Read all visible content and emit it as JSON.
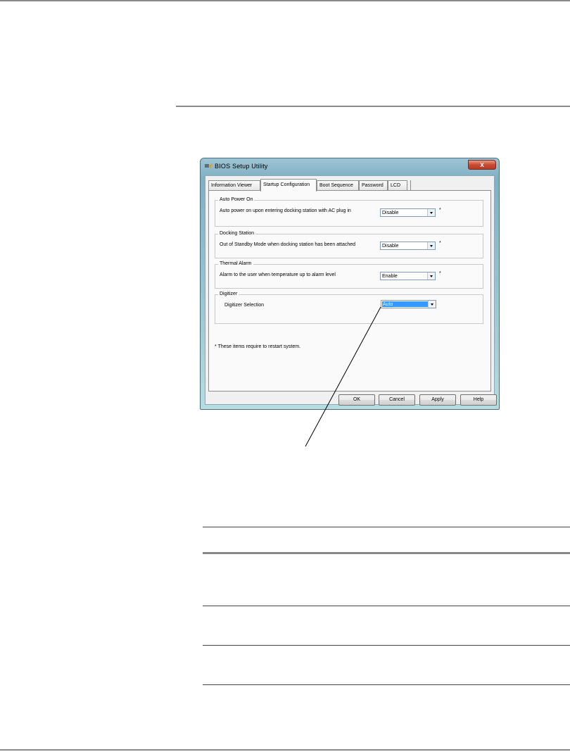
{
  "window": {
    "title": "BIOS Setup Utility",
    "close_glyph": "x"
  },
  "tabs": [
    {
      "label": "Information Viewer"
    },
    {
      "label": "Startup Configuration"
    },
    {
      "label": "Boot Sequence"
    },
    {
      "label": "Password"
    },
    {
      "label": "LCD"
    }
  ],
  "active_tab": "Startup Configuration",
  "groups": {
    "auto_power_on": {
      "title": "Auto Power On",
      "text": "Auto power on upon entering docking station with AC plug in",
      "value": "Disable",
      "asterisk": "*"
    },
    "docking_station": {
      "title": "Docking Station",
      "text": "Out of Standby Mode when docking station has been attached",
      "value": "Disable",
      "asterisk": "*"
    },
    "thermal_alarm": {
      "title": "Thermal Alarm",
      "text": "Alarm to the user when temperature up to alarm level",
      "value": "Enable",
      "asterisk": "*"
    },
    "digitizer": {
      "title": "Digitizer",
      "text": "Digitizer Selection",
      "value": "Auto"
    }
  },
  "note": "* These items require to restart system.",
  "buttons": {
    "ok": "OK",
    "cancel": "Cancel",
    "apply": "Apply",
    "help": "Help"
  },
  "icons": {
    "app": "bios-utility-icon",
    "close": "close-icon",
    "dropdown": "chevron-down-icon"
  },
  "colors": {
    "selection": "#3399ff",
    "close_button": "#c94a32",
    "rule": "#8a8a8a"
  }
}
